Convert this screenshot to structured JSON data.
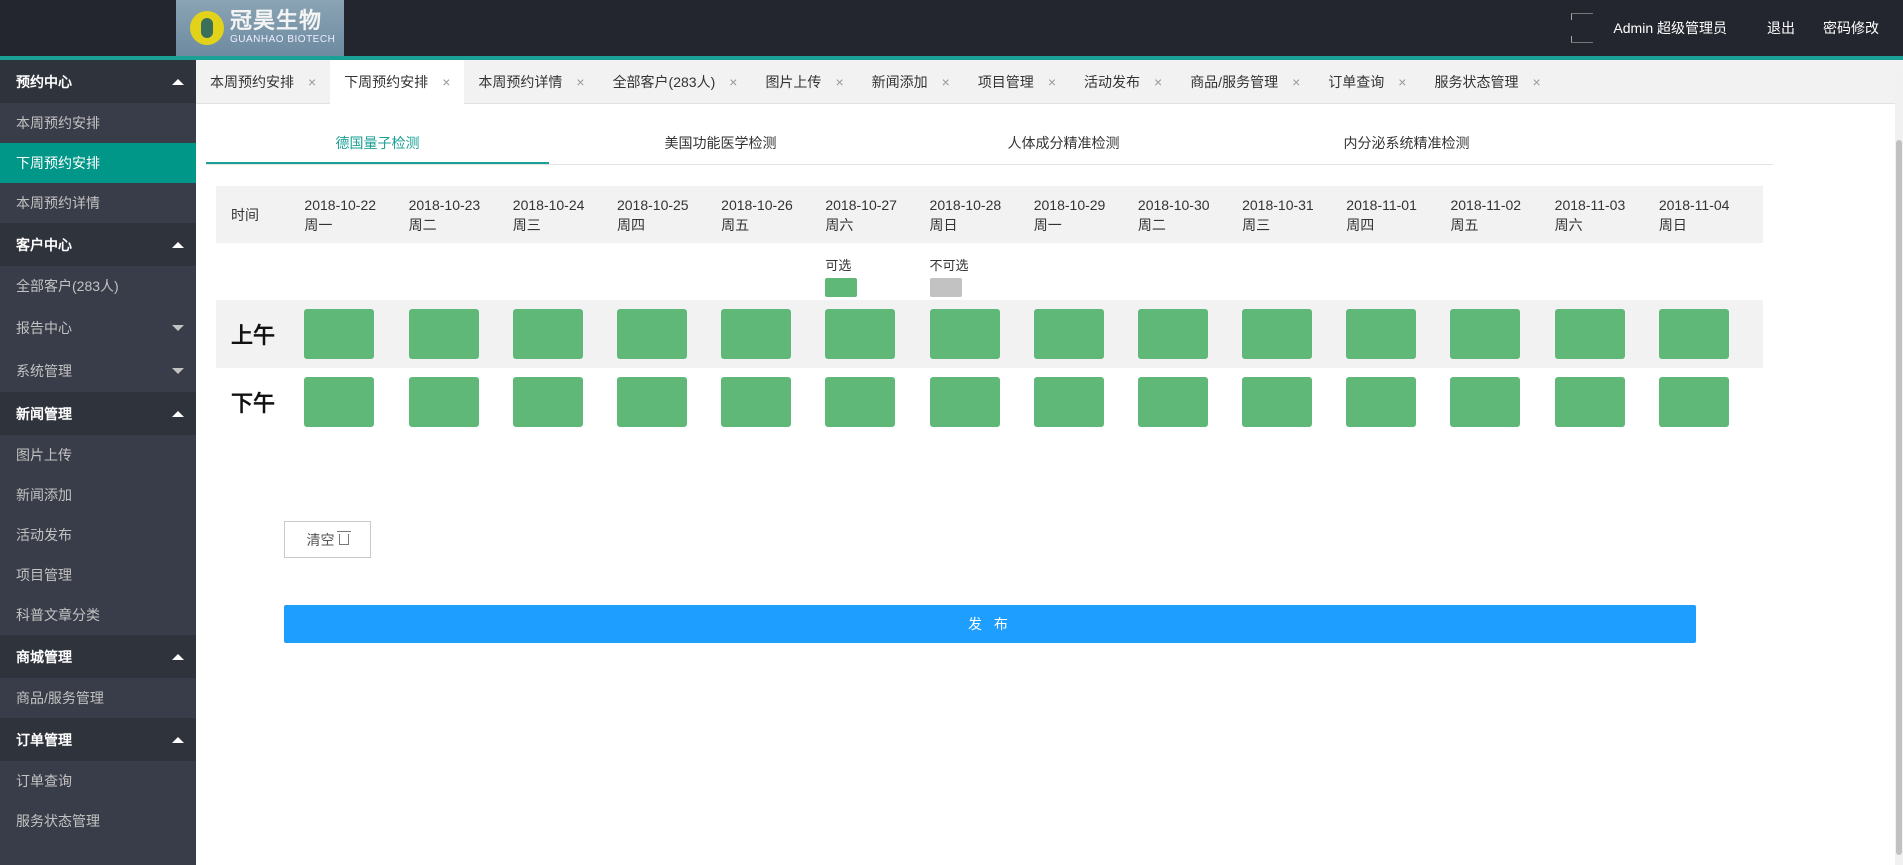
{
  "header": {
    "logo_cn": "冠昊生物",
    "logo_en": "GUANHAO BIOTECH",
    "user": "Admin 超级管理员",
    "logout": "退出",
    "change_password": "密码修改"
  },
  "sidebar": {
    "groups": [
      {
        "title": "预约中心",
        "expanded": true,
        "items": [
          "本周预约安排",
          "下周预约安排",
          "本周预约详情"
        ]
      },
      {
        "title": "客户中心",
        "expanded": true,
        "items": [
          "全部客户(283人)"
        ]
      },
      {
        "title": "报告中心",
        "expanded": false,
        "items": []
      },
      {
        "title": "系统管理",
        "expanded": false,
        "items": []
      },
      {
        "title": "新闻管理",
        "expanded": true,
        "items": [
          "图片上传",
          "新闻添加",
          "活动发布",
          "项目管理",
          "科普文章分类"
        ]
      },
      {
        "title": "商城管理",
        "expanded": true,
        "items": [
          "商品/服务管理"
        ]
      },
      {
        "title": "订单管理",
        "expanded": true,
        "items": [
          "订单查询",
          "服务状态管理"
        ]
      }
    ],
    "active_item": "下周预约安排"
  },
  "tabs": [
    "本周预约安排",
    "下周预约安排",
    "本周预约详情",
    "全部客户(283人)",
    "图片上传",
    "新闻添加",
    "项目管理",
    "活动发布",
    "商品/服务管理",
    "订单查询",
    "服务状态管理"
  ],
  "active_tab": 1,
  "subtabs": [
    "德国量子检测",
    "美国功能医学检测",
    "人体成分精准检测",
    "内分泌系统精准检测"
  ],
  "active_subtab": 0,
  "schedule": {
    "time_label": "时间",
    "days": [
      {
        "date": "2018-10-22",
        "weekday": "周一"
      },
      {
        "date": "2018-10-23",
        "weekday": "周二"
      },
      {
        "date": "2018-10-24",
        "weekday": "周三"
      },
      {
        "date": "2018-10-25",
        "weekday": "周四"
      },
      {
        "date": "2018-10-26",
        "weekday": "周五"
      },
      {
        "date": "2018-10-27",
        "weekday": "周六"
      },
      {
        "date": "2018-10-28",
        "weekday": "周日"
      },
      {
        "date": "2018-10-29",
        "weekday": "周一"
      },
      {
        "date": "2018-10-30",
        "weekday": "周二"
      },
      {
        "date": "2018-10-31",
        "weekday": "周三"
      },
      {
        "date": "2018-11-01",
        "weekday": "周四"
      },
      {
        "date": "2018-11-02",
        "weekday": "周五"
      },
      {
        "date": "2018-11-03",
        "weekday": "周六"
      },
      {
        "date": "2018-11-04",
        "weekday": "周日"
      }
    ],
    "legend": {
      "available": "可选",
      "unavailable": "不可选"
    },
    "slots": [
      "上午",
      "下午"
    ],
    "available_color": "#5fb878",
    "unavailable_color": "#c2c2c2"
  },
  "buttons": {
    "clear": "清空",
    "publish": "发 布"
  }
}
